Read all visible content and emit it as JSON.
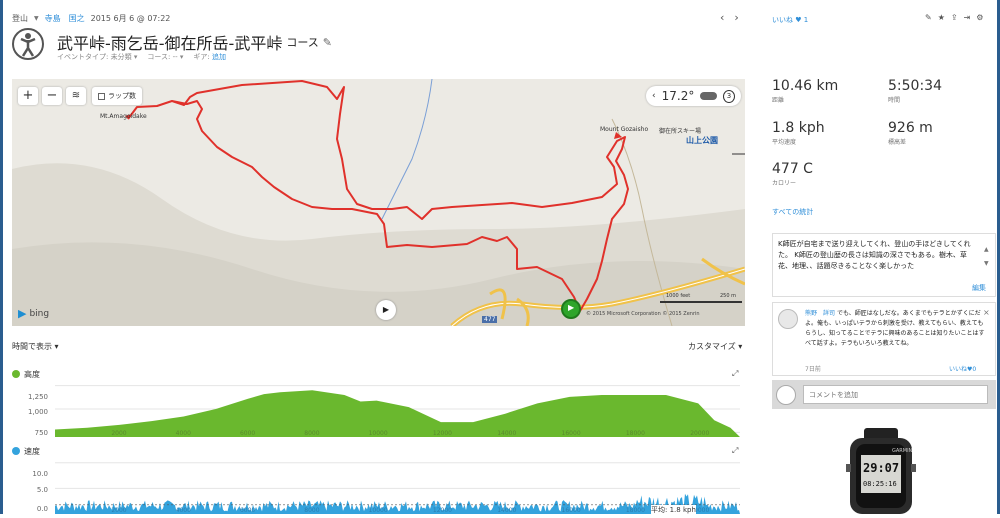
{
  "header": {
    "activity_type": "登山",
    "user": "寺島　国之",
    "date": "2015 6月 6 @ 07:22",
    "title_main": "武平峠-雨乞岳-御在所岳-武平峠",
    "title_suffix": "コース",
    "event_type_label": "イベントタイプ: 未分類",
    "course_label": "コース: --",
    "gear_label": "ギア:",
    "gear_link": "追加",
    "prev_arrow": "‹",
    "next_arrow": "›"
  },
  "map": {
    "zoom_in": "+",
    "zoom_out": "−",
    "lap_label": "ラップ数",
    "temperature": "17.2°",
    "wind_value": "3",
    "label_amagoidake": "Mt.Amagoidake",
    "label_gozaisho": "Mount Gozaisho",
    "label_ski": "御在所スキー場",
    "label_park": "山上公園",
    "route_no": "477",
    "scale_feet": "1000 feet",
    "scale_m": "250 m",
    "copyright": "© 2015 Microsoft Corporation   © 2015 Zenrin",
    "bing": "bing",
    "play_icon": "▶"
  },
  "graph_controls": {
    "display_by": "時間で表示",
    "customize": "カスタマイズ"
  },
  "chart_data": [
    {
      "type": "area",
      "title": "高度",
      "color": "#6ab82e",
      "x": [
        0,
        1000,
        2000,
        3000,
        4000,
        5000,
        6000,
        6500,
        7000,
        8000,
        9000,
        9500,
        10000,
        11000,
        12000,
        13000,
        14000,
        15000,
        16000,
        17000,
        18000,
        19000,
        20000,
        20500,
        21000
      ],
      "y": [
        780,
        800,
        830,
        870,
        920,
        1000,
        1110,
        1160,
        1180,
        1200,
        1150,
        1080,
        1090,
        1020,
        860,
        860,
        950,
        1060,
        1130,
        1150,
        1150,
        1150,
        1060,
        880,
        800
      ],
      "yticks": [
        "1,250",
        "1,000",
        "750"
      ],
      "xticks": [
        "2000",
        "4000",
        "6000",
        "8000",
        "10000",
        "12000",
        "14000",
        "16000",
        "18000",
        "20000"
      ],
      "ylim": [
        700,
        1300
      ],
      "xlim": [
        0,
        21300
      ]
    },
    {
      "type": "area",
      "title": "速度",
      "color": "#34a3dd",
      "yticks": [
        "10.0",
        "5.0",
        "0.0"
      ],
      "xticks": [
        "2000",
        "4000",
        "6000",
        "8000",
        "10000",
        "12000",
        "14000",
        "16000",
        "18000",
        "20000"
      ],
      "ylim": [
        0,
        10
      ],
      "avg_label": "平均: 1.8 kph"
    }
  ],
  "stats": {
    "likes": "いいね",
    "likes_count": "1",
    "distance": "10.46 km",
    "distance_label": "距離",
    "time": "5:50:34",
    "time_label": "時間",
    "avg_speed": "1.8 kph",
    "avg_speed_label": "平均速度",
    "elevation": "926 m",
    "elevation_label": "標高差",
    "calories": "477 C",
    "calories_label": "カロリー",
    "all_stats": "すべての統計"
  },
  "note": {
    "text": "K師匠が自宅まで送り迎えしてくれ、登山の手ほどきしてくれた。 K師匠の登山歴の長さは知識の深さでもある。樹木、草花、地理、、話題尽きることなく楽しかった",
    "edit": "編集"
  },
  "comment": {
    "author": "熊野　詳司",
    "text": "でも、師匠はなしだな。あくまでもテラとかずくにだよ。俺も、いっぱいテラから刺激を受け、教えてもらい、教えてもらうし、知ってることでテラに興味のあることは知りたいことはすべて話すよ。テラもいろいろ教えてね。",
    "time": "7日前",
    "like": "いいね",
    "like_count": "0",
    "close": "×"
  },
  "add_comment": {
    "placeholder": "コメントを追加"
  },
  "device": {
    "brand": "GARMIN",
    "screen_top": "29:07",
    "screen_bottom": "08:25:16"
  }
}
